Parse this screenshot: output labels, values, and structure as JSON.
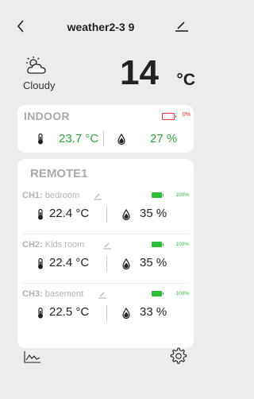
{
  "header": {
    "title": "weather2-3 9"
  },
  "current": {
    "condition": "Cloudy",
    "temperature": "14",
    "unit": "°C"
  },
  "indoor": {
    "title": "INDOOR",
    "battery": "0%",
    "temperature": "23.7 °C",
    "humidity": "27 %"
  },
  "remote": {
    "title": "REMOTE1",
    "channels": [
      {
        "id": "CH1:",
        "name": "bedroom",
        "battery": "100%",
        "temperature": "22.4 °C",
        "humidity": "35 %"
      },
      {
        "id": "CH2:",
        "name": "Kids room",
        "battery": "100%",
        "temperature": "22.4 °C",
        "humidity": "35 %"
      },
      {
        "id": "CH3:",
        "name": "basement",
        "battery": "100%",
        "temperature": "22.5 °C",
        "humidity": "33 %"
      }
    ]
  },
  "colors": {
    "accent_green": "#2fa43a",
    "battery_low": "#e03030",
    "battery_full": "#2fbd3c"
  },
  "icons": [
    "back-arrow-icon",
    "edit-pencil-icon",
    "cloudy-weather-icon",
    "thermometer-icon",
    "water-drop-icon",
    "battery-icon",
    "chart-icon",
    "gear-icon"
  ]
}
